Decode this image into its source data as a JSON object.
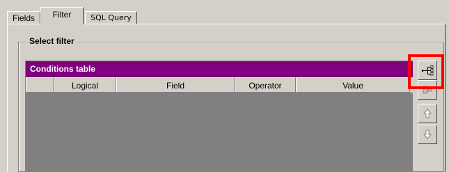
{
  "tabs": [
    {
      "label": "Fields"
    },
    {
      "label": "Filter",
      "selected": true
    },
    {
      "label": "SQL Query"
    }
  ],
  "groupbox": {
    "label": "Select filter"
  },
  "conditions_table": {
    "title": "Conditions table",
    "title_color": "#800080",
    "columns": [
      "",
      "Logical",
      "Field",
      "Operator",
      "Value"
    ]
  },
  "side_buttons": [
    {
      "icon": "add-condition-icon",
      "highlighted": true
    },
    {
      "icon": "remove-condition-icon"
    },
    {
      "icon": "arrow-up-icon"
    },
    {
      "icon": "arrow-down-icon"
    }
  ],
  "colors": {
    "highlight": "#ff0000",
    "face": "#d4d0c8",
    "body": "#808080"
  }
}
